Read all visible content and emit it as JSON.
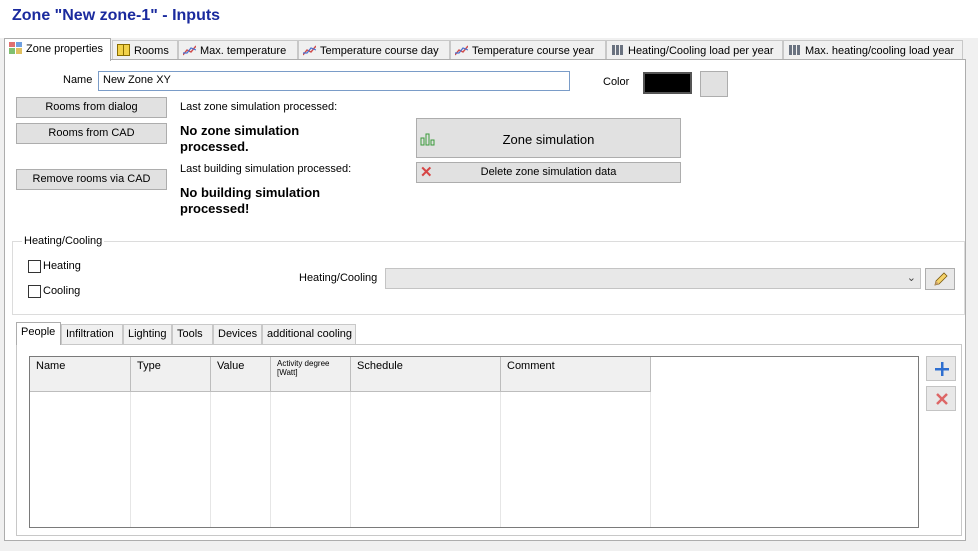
{
  "window": {
    "title": "Zone \"New zone-1\" - Inputs"
  },
  "tabs": [
    {
      "label": "Zone properties",
      "icon": "zone-icon"
    },
    {
      "label": "Rooms",
      "icon": "rooms-icon"
    },
    {
      "label": "Max. temperature",
      "icon": "line-chart-icon"
    },
    {
      "label": "Temperature course day",
      "icon": "line-chart-icon"
    },
    {
      "label": "Temperature course year",
      "icon": "line-chart-icon"
    },
    {
      "label": "Heating/Cooling load per year",
      "icon": "radiator-icon"
    },
    {
      "label": "Max. heating/cooling load year",
      "icon": "radiator-icon"
    }
  ],
  "zone": {
    "name_label": "Name",
    "name_value": "New Zone XY",
    "color_label": "Color",
    "color_value": "#000000"
  },
  "buttons": {
    "rooms_from_dialog": "Rooms from dialog",
    "rooms_from_cad": "Rooms from CAD",
    "remove_rooms_via_cad": "Remove rooms via CAD",
    "zone_simulation": "Zone simulation",
    "delete_zone_simulation_data": "Delete zone simulation data"
  },
  "status": {
    "last_zone_label": "Last zone simulation processed:",
    "last_zone_value_line1": "No zone simulation",
    "last_zone_value_line2": "processed.",
    "last_building_label": "Last building simulation processed:",
    "last_building_value_line1": "No building simulation",
    "last_building_value_line2": "processed!"
  },
  "heating_cooling": {
    "group_title": "Heating/Cooling",
    "heating_label": "Heating",
    "cooling_label": "Cooling",
    "heating_checked": false,
    "cooling_checked": false,
    "select_label": "Heating/Cooling",
    "select_value": ""
  },
  "sub_tabs": [
    "People",
    "Infiltration",
    "Lighting",
    "Tools",
    "Devices",
    "additional cooling"
  ],
  "people_table": {
    "columns": [
      "Name",
      "Type",
      "Value",
      "Activity degree",
      "[Watt]",
      "Schedule",
      "Comment"
    ],
    "rows": []
  }
}
